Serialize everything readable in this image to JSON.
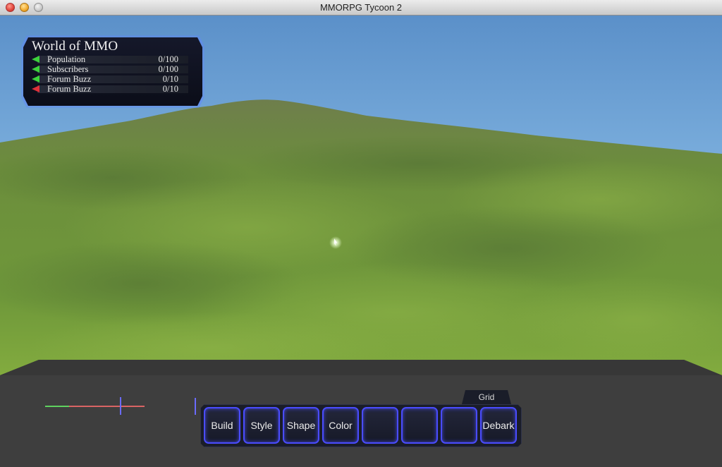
{
  "window": {
    "title": "MMORPG Tycoon 2"
  },
  "stats": {
    "world_name": "World of MMO",
    "rows": [
      {
        "label": "Population",
        "value": "0/100",
        "trend": "up"
      },
      {
        "label": "Subscribers",
        "value": "0/100",
        "trend": "up"
      },
      {
        "label": "Forum Buzz",
        "value": "0/10",
        "trend": "up"
      },
      {
        "label": "Forum Buzz",
        "value": "0/10",
        "trend": "down"
      }
    ]
  },
  "toolbar": {
    "tab_label": "Grid",
    "buttons": [
      "Build",
      "Style",
      "Shape",
      "Color",
      "",
      "",
      "",
      "Debark"
    ]
  },
  "icons": {
    "trend_up": "green-left-arrow-icon",
    "trend_down": "red-left-arrow-icon",
    "cursor": "glowing-cursor-icon"
  },
  "colors": {
    "accent": "#4a4cff",
    "trend_up": "#3cd23c",
    "trend_down": "#e0303a",
    "panel_glow": "#5f86ff"
  }
}
